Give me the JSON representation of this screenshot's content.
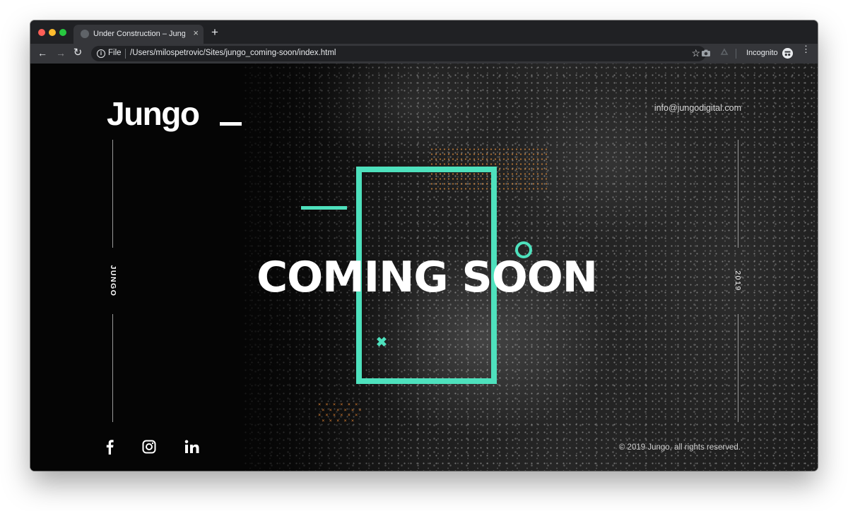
{
  "browser": {
    "tab_title": "Under Construction – Jungo_",
    "tab_close_icon": "×",
    "new_tab_icon": "+",
    "url_scheme_label": "File",
    "url_path": "/Users/milospetrovic/Sites/jungo_coming-soon/index.html",
    "incognito_label": "Incognito",
    "icons": {
      "back": "←",
      "forward": "→",
      "reload": "↻",
      "info": "i",
      "star": "☆",
      "menu": "⋮"
    }
  },
  "page": {
    "logo": "Jungo",
    "email": "info@jungodigital.com",
    "side_left": "JUNGO",
    "side_right": "2019",
    "headline": "COMING SOON",
    "copyright": "© 2019 Jungo, all rights reserved.",
    "accent_color": "#4ee1bd",
    "decor_x": "✖",
    "social": [
      "facebook-icon",
      "instagram-icon",
      "linkedin-icon"
    ]
  }
}
